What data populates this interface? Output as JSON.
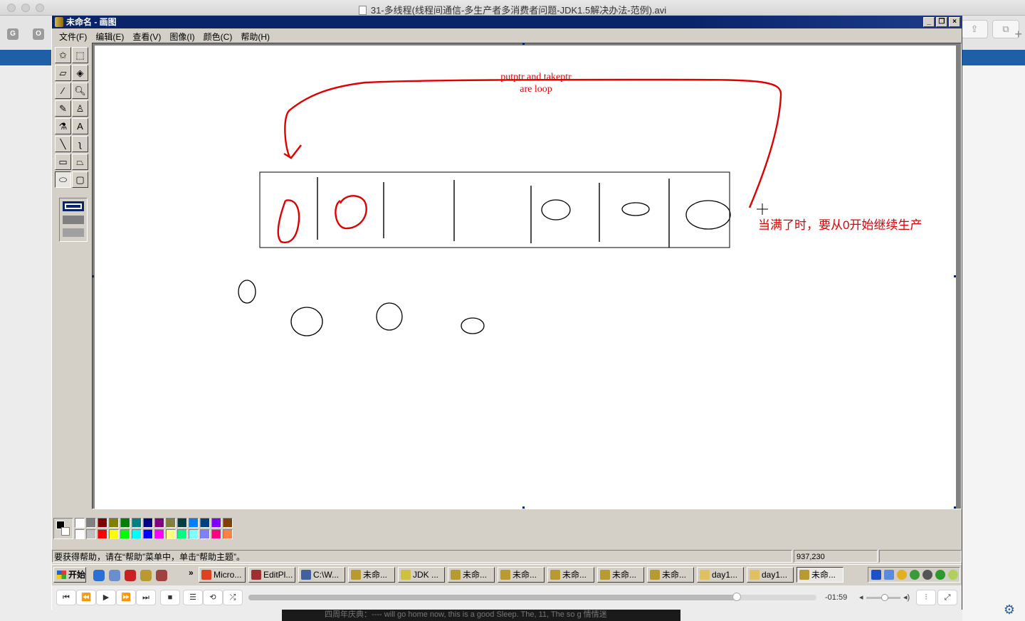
{
  "mac": {
    "title": "31-多线程(线程间通信-多生产者多消费者问题-JDK1.5解决办法-范例).avi",
    "fav_icons": [
      "G",
      "O"
    ],
    "toolbar_buttons": [
      "share",
      "windows"
    ],
    "behind_text": "四周年庆典：---- will go home now, this is a good Sleep. The, 11, The so g 情情迷"
  },
  "paint": {
    "window_title": "未命名 - 画图",
    "window_controls": [
      "_",
      "❐",
      "×"
    ],
    "menu": [
      "文件(F)",
      "编辑(E)",
      "查看(V)",
      "图像(I)",
      "颜色(C)",
      "帮助(H)"
    ],
    "tools": [
      {
        "name": "free-select",
        "glyph": "✩"
      },
      {
        "name": "select",
        "glyph": "⬚"
      },
      {
        "name": "eraser",
        "glyph": "▱"
      },
      {
        "name": "fill",
        "glyph": "◈"
      },
      {
        "name": "pick-color",
        "glyph": "⁄"
      },
      {
        "name": "magnifier",
        "glyph": "🔍︎"
      },
      {
        "name": "pencil",
        "glyph": "✎"
      },
      {
        "name": "brush",
        "glyph": "♙"
      },
      {
        "name": "airbrush",
        "glyph": "⚗"
      },
      {
        "name": "text",
        "glyph": "A"
      },
      {
        "name": "line",
        "glyph": "╲"
      },
      {
        "name": "curve",
        "glyph": "ʅ"
      },
      {
        "name": "rectangle",
        "glyph": "▭"
      },
      {
        "name": "polygon",
        "glyph": "⏢"
      },
      {
        "name": "ellipse",
        "glyph": "⬭"
      },
      {
        "name": "rounded-rect",
        "glyph": "▢"
      }
    ],
    "canvas": {
      "note_en": "putptr and takeptr are loop",
      "note_cn": "当满了时，要从0开始继续生产",
      "ink_color": "#e00000"
    },
    "palette_top": [
      "#ffffff",
      "#808080",
      "#800000",
      "#808000",
      "#008000",
      "#008080",
      "#000080",
      "#800080",
      "#808040",
      "#004040",
      "#0080ff",
      "#004080",
      "#8000ff",
      "#804000"
    ],
    "palette_bottom": [
      "#ffffff",
      "#c0c0c0",
      "#ff0000",
      "#ffff00",
      "#00ff00",
      "#00ffff",
      "#0000ff",
      "#ff00ff",
      "#ffff80",
      "#00ff80",
      "#80ffff",
      "#8080ff",
      "#ff0080",
      "#ff8040"
    ],
    "status": {
      "help_text": "要获得帮助，请在“帮助”菜单中，单击“帮助主题”。",
      "coords": "937,230",
      "size": ""
    }
  },
  "taskbar": {
    "start_label": "开始",
    "tasks": [
      "Micro...",
      "EditPl...",
      "C:\\W...",
      "未命...",
      "JDK ...",
      "未命...",
      "未命...",
      "未命...",
      "未命...",
      "未命...",
      "day1...",
      "day1...",
      "未命..."
    ]
  },
  "player": {
    "remaining_time": "-01:59",
    "progress": 0.86,
    "volume": 0.55
  }
}
